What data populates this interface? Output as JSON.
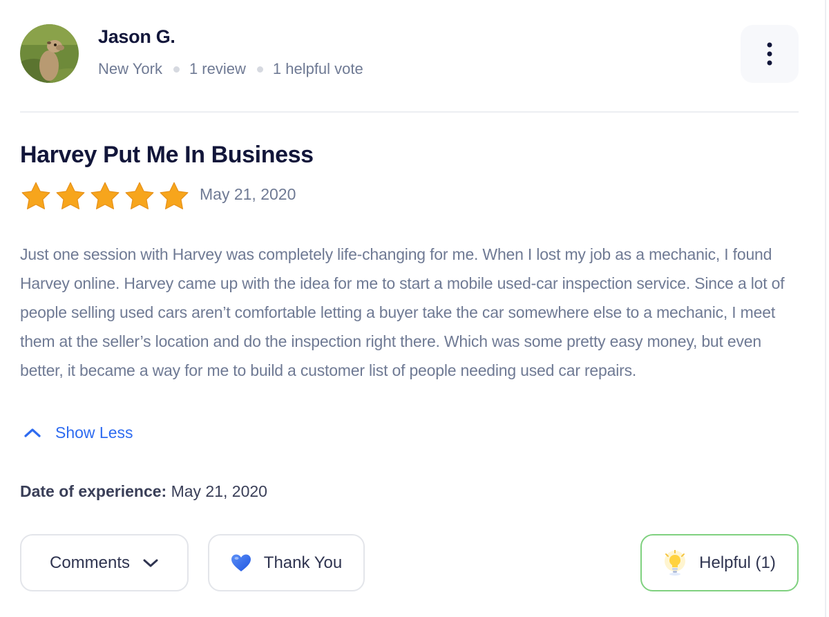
{
  "reviewer": {
    "name": "Jason G.",
    "location": "New York",
    "reviews": "1 review",
    "helpful_votes": "1 helpful vote",
    "avatar_icon": "meerkat-avatar"
  },
  "menu": {
    "icon": "vertical-ellipsis-icon"
  },
  "review": {
    "title": "Harvey Put Me In Business",
    "rating": 5,
    "rating_max": 5,
    "star_color": "#F7A51C",
    "date": "May 21, 2020",
    "body": "Just one session with Harvey was completely life-changing for me. When I lost my job as a mechanic, I found Harvey online. Harvey came up with the idea for me to start a mobile used-car inspection service. Since a lot of people selling used cars aren’t comfortable letting a buyer take the car somewhere else to a mechanic, I meet them at the seller’s location and do the inspection right there. Which was some pretty easy money, but even better, it became a way for me to build a customer list of people needing used car repairs.",
    "show_less_label": "Show Less",
    "experience_label": "Date of experience",
    "experience_date": "May 21, 2020"
  },
  "actions": {
    "comments_label": "Comments",
    "thank_you_label": "Thank You",
    "helpful_label": "Helpful (1)"
  },
  "colors": {
    "link": "#2E6BF0",
    "helpful_border": "#7FD17F",
    "heart": "#2F6BF2"
  }
}
